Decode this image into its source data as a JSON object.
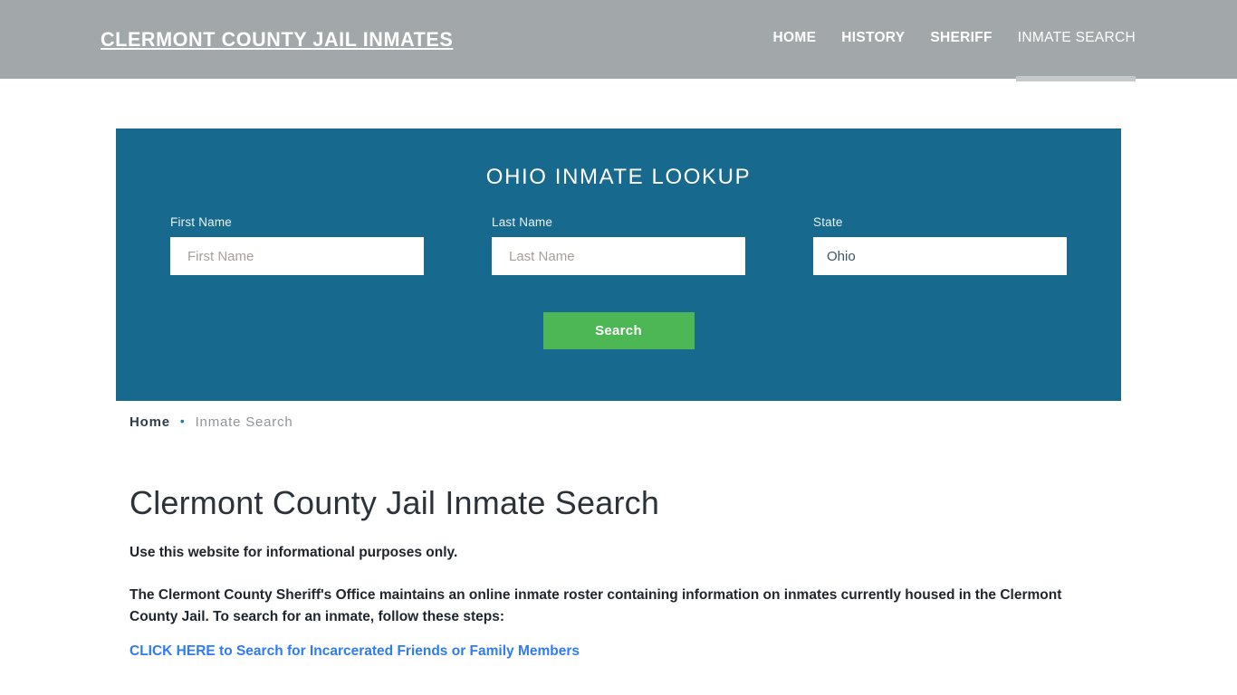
{
  "header": {
    "brand": "Clermont County Jail Inmates",
    "nav": [
      {
        "label": "Home",
        "active": false
      },
      {
        "label": "History",
        "active": false
      },
      {
        "label": "Sheriff",
        "active": false
      },
      {
        "label": "Inmate Search",
        "active": true
      }
    ]
  },
  "search_panel": {
    "title": "Ohio Inmate Lookup",
    "fields": [
      {
        "label": "First Name",
        "placeholder": "First Name",
        "value": ""
      },
      {
        "label": "Last Name",
        "placeholder": "Last Name",
        "value": ""
      }
    ],
    "state_field": {
      "label": "State",
      "selected": "Ohio",
      "options": [
        "Ohio"
      ]
    },
    "submit_label": "Search"
  },
  "breadcrumb": {
    "home": "Home",
    "separator": "•",
    "current": "Inmate Search"
  },
  "main": {
    "title": "Clermont County Jail Inmate Search",
    "paragraphs": [
      "Use this website for informational purposes only.",
      "The Clermont County Sheriff's Office maintains an online inmate roster containing information on inmates currently housed in the Clermont County Jail. To search for an inmate, follow these steps:"
    ],
    "link": "CLICK HERE to Search for Incarcerated Friends or Family Members"
  },
  "colors": {
    "header_gray": "#a2a8aa",
    "panel_blue": "#17698e",
    "button_green": "#4cb754",
    "link_blue": "#2f7bf0",
    "accent_teal": "#1a7fa0"
  }
}
